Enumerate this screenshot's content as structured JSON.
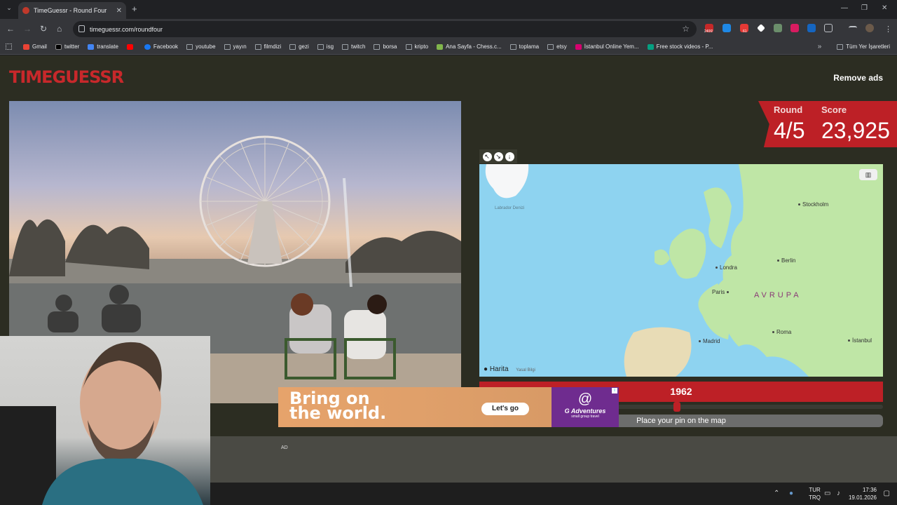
{
  "browser": {
    "tab_title": "TimeGuessr - Round Four",
    "url": "timeguessr.com/roundfour",
    "bookmarks": [
      "Gmail",
      "twitter",
      "translate",
      "Facebook",
      "youtube",
      "yayın",
      "filmdizi",
      "gezi",
      "isg",
      "twitch",
      "borsa",
      "kripto",
      "Ana Sayfa - Chess.c...",
      "toplama",
      "etsy",
      "İstanbul Online Yem...",
      "Free stock videos - P..."
    ],
    "all_bookmarks": "Tüm Yer İşaretleri",
    "ext_badges": [
      "2406!",
      "61"
    ]
  },
  "site": {
    "logo": "TIMEGUESSR",
    "remove_ads": "Remove ads"
  },
  "score": {
    "round_label": "Round",
    "score_label": "Score",
    "round_value": "4/5",
    "score_value": "23,925"
  },
  "map": {
    "cities": [
      "Stockholm",
      "Londra",
      "Berlin",
      "Paris",
      "Roma",
      "Madrid",
      "İstanbul"
    ],
    "region": "AVRUPA",
    "sea": "Labrador Denizi",
    "attribution": "Harita",
    "legal": "Yasal Bilgi",
    "layers_icon": "map-layers-icon"
  },
  "timeline": {
    "year": "1962",
    "year_fraction": 0.49,
    "pin_prompt": "Place your pin on the map"
  },
  "ad": {
    "label": "AD",
    "headline_1": "Bring on",
    "headline_2": "the world.",
    "cta": "Let's go",
    "brand": "G Adventures",
    "brand_tag": "small group travel"
  },
  "taskbar": {
    "lang_1": "TUR",
    "lang_2": "TRQ",
    "time": "17:36",
    "date": "19.01.2026"
  },
  "colors": {
    "accent": "#bd2026",
    "page_bg": "#2c2d22",
    "sea": "#8ed3f0",
    "land": "#bfe6a6"
  }
}
